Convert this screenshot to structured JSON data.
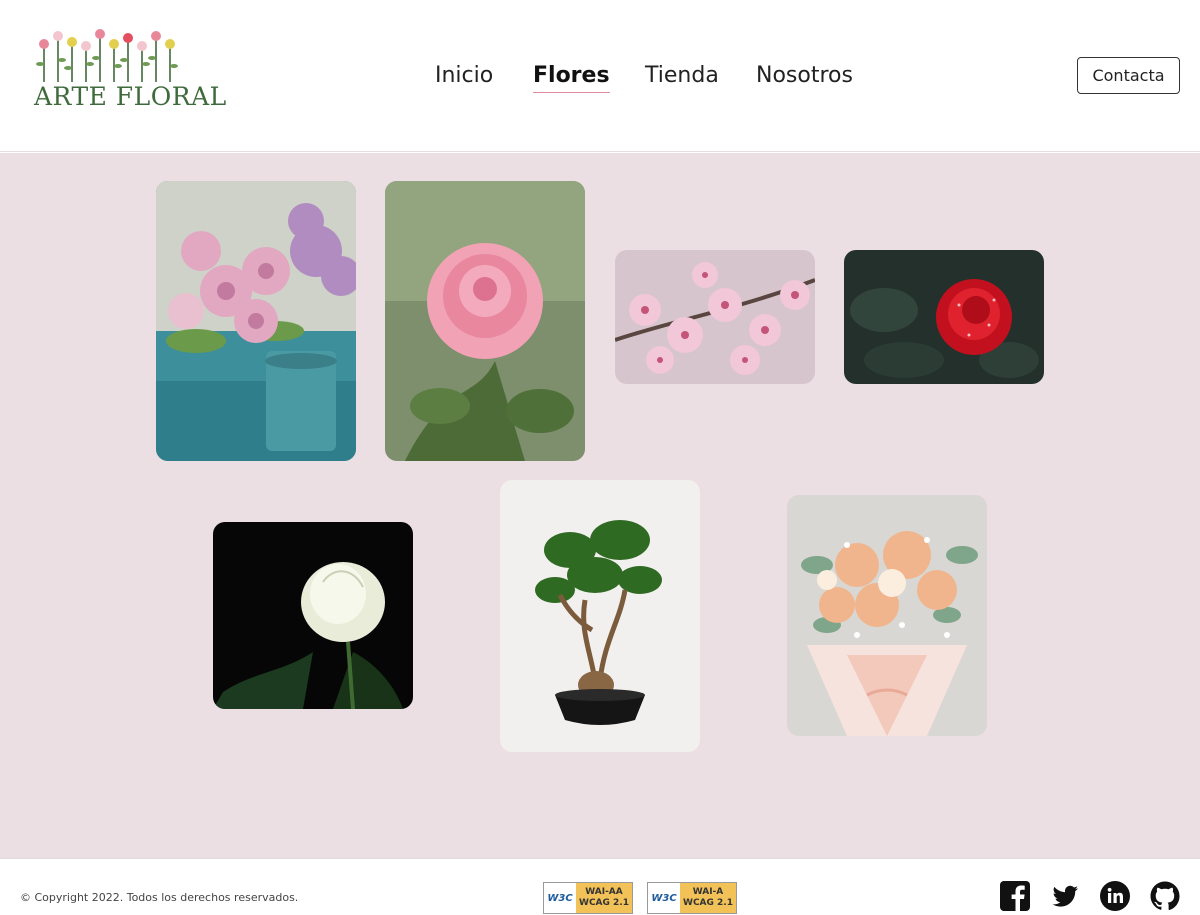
{
  "brand": {
    "name": "ARTE FLORAL",
    "logo_icon": "flowers-logo-icon"
  },
  "nav": {
    "items": [
      {
        "label": "Inicio",
        "active": false
      },
      {
        "label": "Flores",
        "active": true
      },
      {
        "label": "Tienda",
        "active": false
      },
      {
        "label": "Nosotros",
        "active": false
      }
    ],
    "contact_label": "Contacta"
  },
  "gallery": {
    "background_color": "#ebdfe3",
    "photos": [
      {
        "subject": "pink-chrysanthemum-bouquet-in-teal-vase"
      },
      {
        "subject": "pink-rose"
      },
      {
        "subject": "pink-cherry-blossoms"
      },
      {
        "subject": "red-rose-with-dew"
      },
      {
        "subject": "white-rose-on-black"
      },
      {
        "subject": "bonsai-tree-in-black-pot"
      },
      {
        "subject": "wrapped-bouquet-with-gerberas"
      }
    ]
  },
  "footer": {
    "copyright": "© Copyright 2022. Todos los derechos reservados.",
    "badges": [
      {
        "w3c": "W3C",
        "level": "WAI-AA",
        "standard": "WCAG 2.1"
      },
      {
        "w3c": "W3C",
        "level": "WAI-A",
        "standard": "WCAG 2.1"
      }
    ],
    "social": [
      "facebook-icon",
      "twitter-icon",
      "linkedin-icon",
      "github-icon"
    ]
  },
  "colors": {
    "accent": "#e38d9c",
    "logo_green": "#3f6b3c"
  }
}
